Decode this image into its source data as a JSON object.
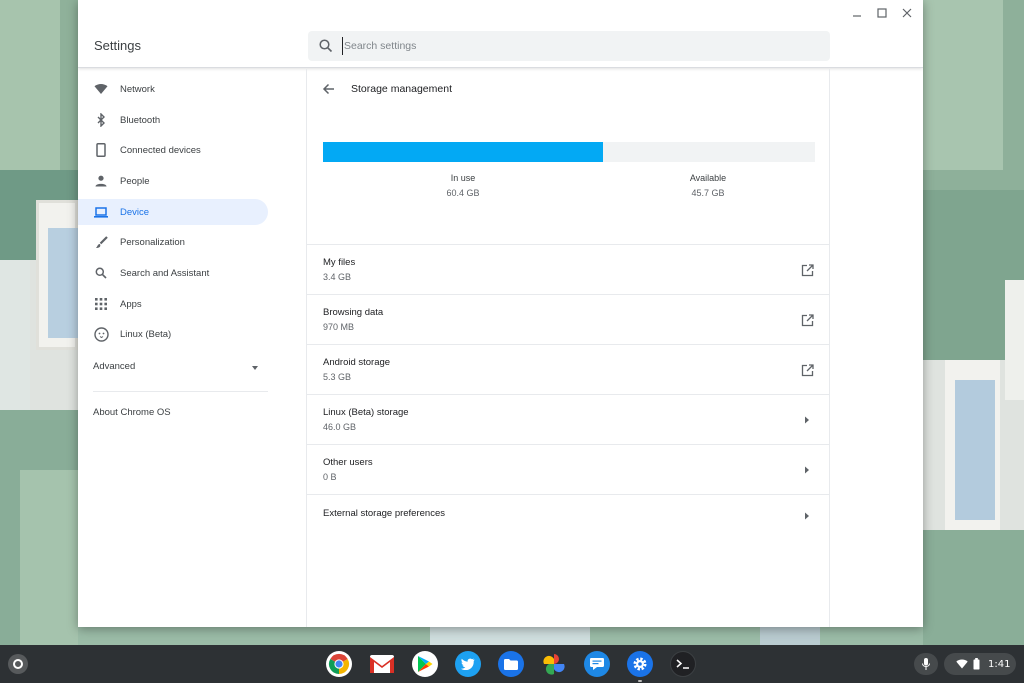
{
  "window": {
    "app_title": "Settings",
    "controls": [
      "minimize-icon",
      "maximize-icon",
      "close-icon"
    ]
  },
  "search": {
    "placeholder": "Search settings",
    "value": ""
  },
  "sidebar": {
    "items": [
      {
        "label": "Network",
        "icon": "wifi-icon",
        "active": false
      },
      {
        "label": "Bluetooth",
        "icon": "bluetooth-icon",
        "active": false
      },
      {
        "label": "Connected devices",
        "icon": "phone-icon",
        "active": false
      },
      {
        "label": "People",
        "icon": "person-icon",
        "active": false
      },
      {
        "label": "Device",
        "icon": "laptop-icon",
        "active": true
      },
      {
        "label": "Personalization",
        "icon": "brush-icon",
        "active": false
      },
      {
        "label": "Search and Assistant",
        "icon": "search-icon",
        "active": false
      },
      {
        "label": "Apps",
        "icon": "apps-grid-icon",
        "active": false
      },
      {
        "label": "Linux (Beta)",
        "icon": "penguin-icon",
        "active": false
      }
    ],
    "advanced_label": "Advanced",
    "about_label": "About Chrome OS"
  },
  "storage": {
    "page_title": "Storage management",
    "in_use_label": "In use",
    "in_use_value": "60.4 GB",
    "available_label": "Available",
    "available_value": "45.7 GB",
    "used_fraction": 0.57,
    "bar_color": "#03a9f4",
    "rows": [
      {
        "name": "My files",
        "value": "3.4 GB",
        "action_icon": "open-external-icon"
      },
      {
        "name": "Browsing data",
        "value": "970 MB",
        "action_icon": "open-external-icon"
      },
      {
        "name": "Android storage",
        "value": "5.3 GB",
        "action_icon": "open-external-icon"
      },
      {
        "name": "Linux (Beta) storage",
        "value": "46.0 GB",
        "action_icon": "chevron-right-icon"
      },
      {
        "name": "Other users",
        "value": "0 B",
        "action_icon": "chevron-right-icon"
      },
      {
        "name": "External storage preferences",
        "value": "",
        "action_icon": "chevron-right-icon"
      }
    ]
  },
  "shelf": {
    "apps": [
      "chrome-icon",
      "gmail-icon",
      "play-store-icon",
      "twitter-icon",
      "files-icon",
      "photos-icon",
      "messages-icon",
      "settings-icon",
      "terminal-icon"
    ],
    "time": "1:41"
  }
}
